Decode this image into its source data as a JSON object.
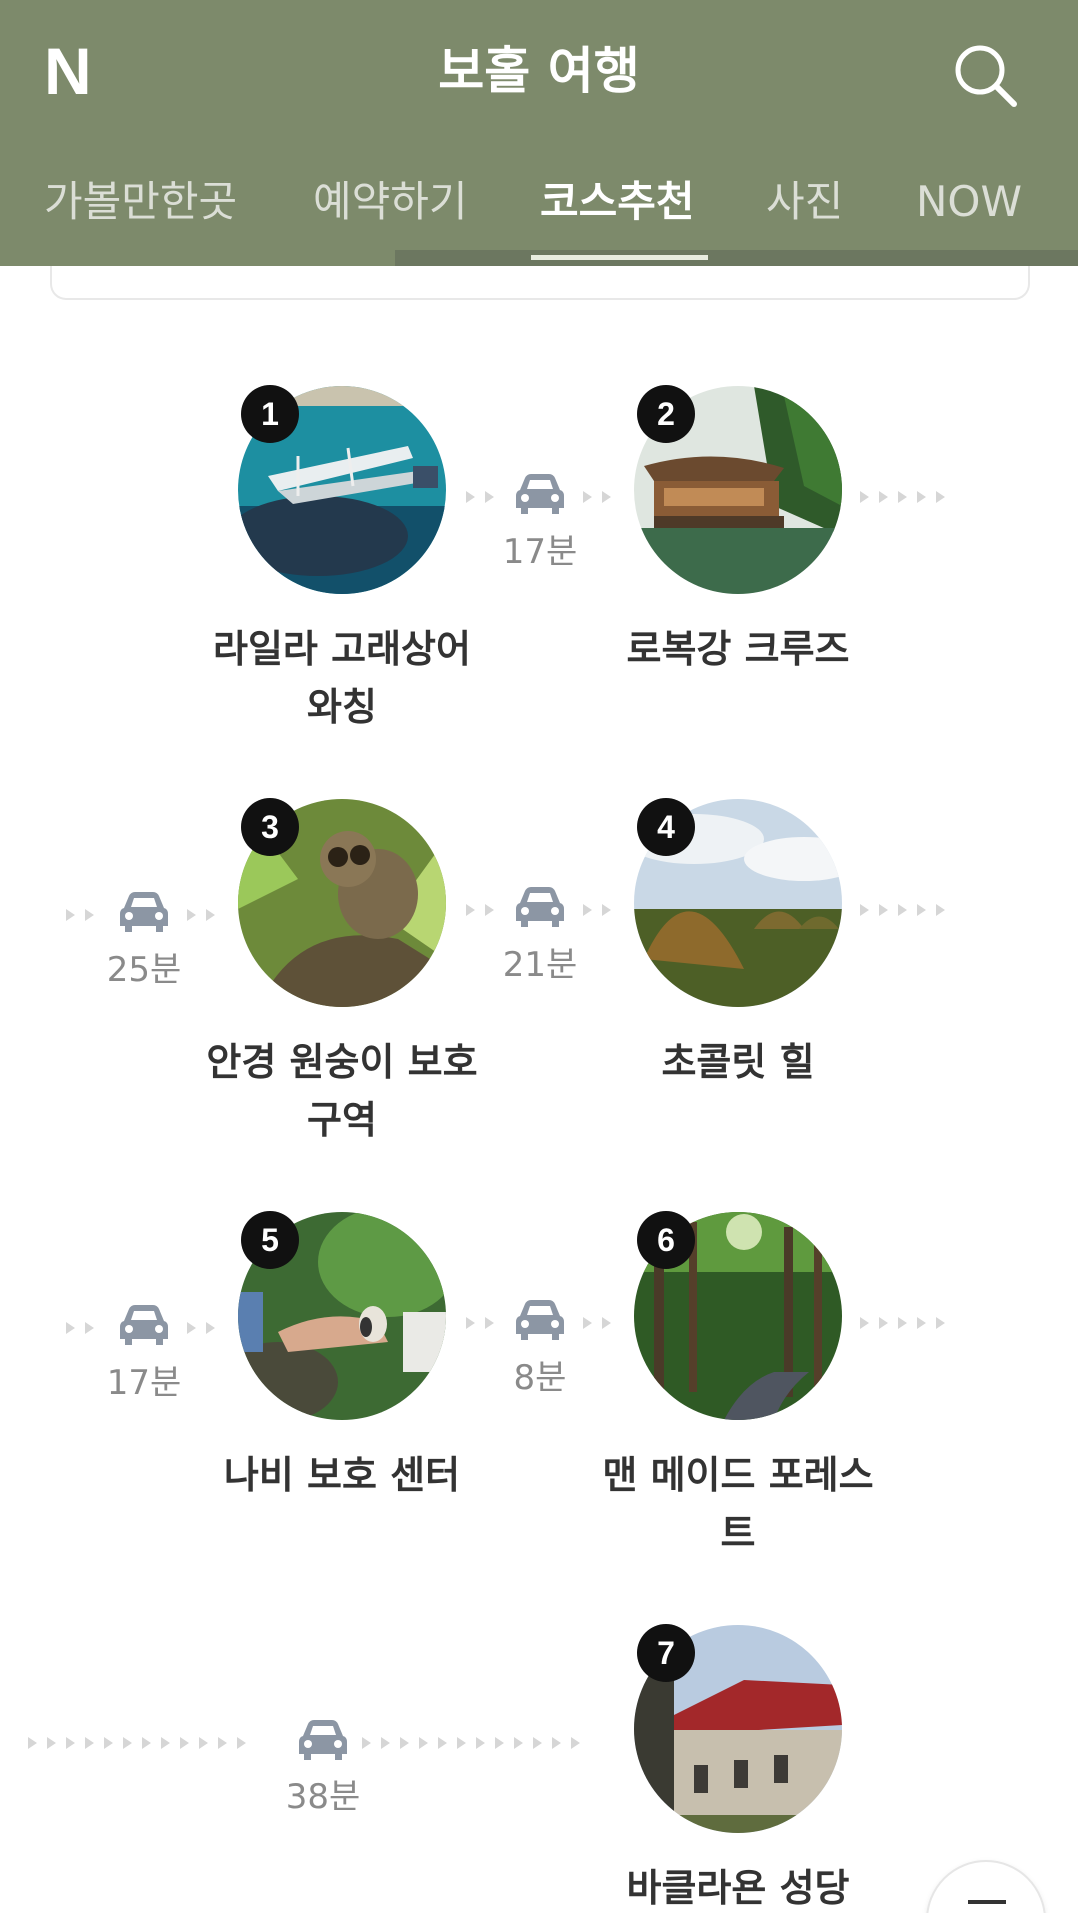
{
  "header": {
    "logo": "N",
    "title": "보홀 여행",
    "search_icon": "search-icon",
    "tabs": [
      {
        "label": "가볼만한곳",
        "active": false
      },
      {
        "label": "예약하기",
        "active": false
      },
      {
        "label": "코스추천",
        "active": true
      },
      {
        "label": "사진",
        "active": false
      },
      {
        "label": "NOW",
        "active": false
      }
    ]
  },
  "course": {
    "stops": [
      {
        "number": "1",
        "name_lines": [
          "라일라 고래상어",
          "와칭"
        ]
      },
      {
        "number": "2",
        "name_lines": [
          "로복강 크루즈",
          ""
        ]
      },
      {
        "number": "3",
        "name_lines": [
          "안경 원숭이 보호",
          "구역"
        ]
      },
      {
        "number": "4",
        "name_lines": [
          "초콜릿 힐",
          ""
        ]
      },
      {
        "number": "5",
        "name_lines": [
          "나비 보호 센터",
          ""
        ]
      },
      {
        "number": "6",
        "name_lines": [
          "맨 메이드 포레스",
          "트"
        ]
      },
      {
        "number": "7",
        "name_lines": [
          "바클라욘 성당",
          ""
        ]
      }
    ],
    "transfers": [
      {
        "mode_icon": "car-icon",
        "duration": "17분"
      },
      {
        "mode_icon": "car-icon",
        "duration": "25분"
      },
      {
        "mode_icon": "car-icon",
        "duration": "21분"
      },
      {
        "mode_icon": "car-icon",
        "duration": "17분"
      },
      {
        "mode_icon": "car-icon",
        "duration": "8분"
      },
      {
        "mode_icon": "car-icon",
        "duration": "38분"
      }
    ]
  },
  "colors": {
    "header_bg": "#7d8a6b",
    "badge_bg": "#111111",
    "arrow": "#d6d6d6",
    "car_icon": "#8c96a4"
  }
}
